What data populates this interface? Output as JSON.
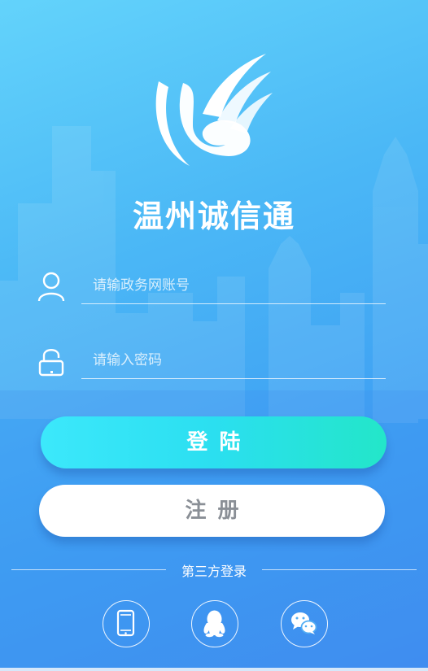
{
  "app": {
    "title": "温州诚信通"
  },
  "login_form": {
    "account_placeholder": "请输政务网账号",
    "password_placeholder": "请输入密码",
    "login_label": "登陆",
    "register_label": "注册"
  },
  "third_party": {
    "label": "第三方登录",
    "options": [
      "phone-icon",
      "qq-icon",
      "wechat-icon"
    ]
  },
  "colors": {
    "background_top": "#63d3fb",
    "background_bottom": "#3f8cf0",
    "login_button_start": "#3ce8fb",
    "login_button_end": "#23e6c9",
    "register_text": "#8a8f96"
  }
}
